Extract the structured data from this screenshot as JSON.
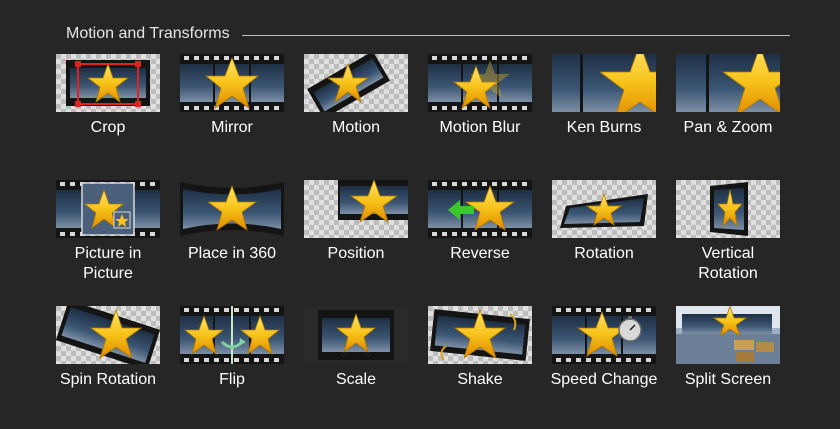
{
  "section": {
    "title": "Motion and Transforms"
  },
  "effects": [
    {
      "label": "Crop"
    },
    {
      "label": "Mirror"
    },
    {
      "label": "Motion"
    },
    {
      "label": "Motion Blur"
    },
    {
      "label": "Ken Burns"
    },
    {
      "label": "Pan & Zoom"
    },
    {
      "label": "Picture in\nPicture"
    },
    {
      "label": "Place in 360"
    },
    {
      "label": "Position"
    },
    {
      "label": "Reverse"
    },
    {
      "label": "Rotation"
    },
    {
      "label": "Vertical\nRotation"
    },
    {
      "label": "Spin Rotation"
    },
    {
      "label": "Flip"
    },
    {
      "label": "Scale"
    },
    {
      "label": "Shake"
    },
    {
      "label": "Speed Change"
    },
    {
      "label": "Split Screen"
    }
  ],
  "colors": {
    "star": "#f7c31a",
    "film": "#141414",
    "frame": "#2f4a68",
    "checker_light": "#e0e0e0",
    "checker_dark": "#bdbdbd",
    "crop_handle": "#e0231f",
    "reverse_arrow": "#39c82a"
  }
}
